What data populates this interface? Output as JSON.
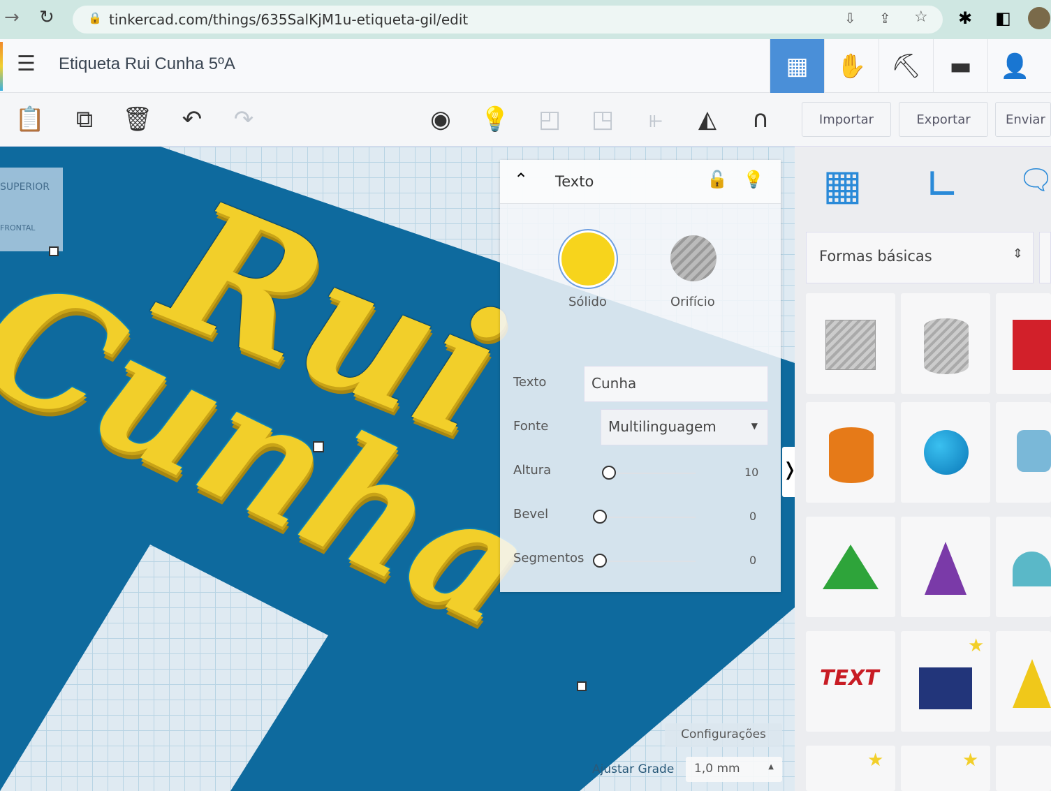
{
  "browser": {
    "url": "tinkercad.com/things/635SalKjM1u-etiqueta-gil/edit"
  },
  "header": {
    "title": "Etiqueta Rui Cunha 5ºA",
    "active_color": "#4a8fd8"
  },
  "toolbar": {
    "import": "Importar",
    "export": "Exportar",
    "send": "Enviar p"
  },
  "viewcube": {
    "top": "SUPERIOR",
    "front": "FRONTAL"
  },
  "scene": {
    "word1": "Rui",
    "word2": "Cunha"
  },
  "panel": {
    "title": "Texto",
    "solid": "Sólido",
    "hole": "Orifício",
    "solid_color": "#f7d41c",
    "fields": {
      "text_label": "Texto",
      "text_value": "Cunha",
      "font_label": "Fonte",
      "font_value": "Multilinguagem",
      "height_label": "Altura",
      "height_value": "10",
      "bevel_label": "Bevel",
      "bevel_value": "0",
      "segments_label": "Segmentos",
      "segments_value": "0"
    }
  },
  "sidebar": {
    "library": "Formas básicas"
  },
  "footer": {
    "settings": "Configurações",
    "snap_label": "Ajustar Grade",
    "snap_value": "1,0 mm"
  }
}
